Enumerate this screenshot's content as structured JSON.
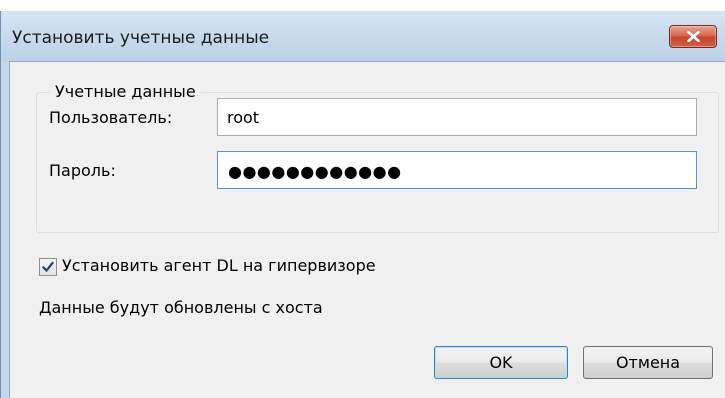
{
  "dialog": {
    "title": "Установить учетные данные",
    "close_icon": "close-icon"
  },
  "credentials": {
    "group_label": "Учетные данные",
    "user_label": "Пользователь:",
    "user_value": "root",
    "password_label": "Пароль:",
    "password_masked": "●●●●●●●●●●●●"
  },
  "options": {
    "install_agent_label": "Установить агент DL на гипервизоре",
    "install_agent_checked": true,
    "info_text": "Данные будут обновлены с хоста"
  },
  "buttons": {
    "ok_label": "OK",
    "cancel_label": "Отмена"
  },
  "colors": {
    "titlebar": "#c7d9ec",
    "close_button": "#c7452d",
    "client_bg": "#f0f0f0",
    "focus_border": "#5696d4"
  }
}
